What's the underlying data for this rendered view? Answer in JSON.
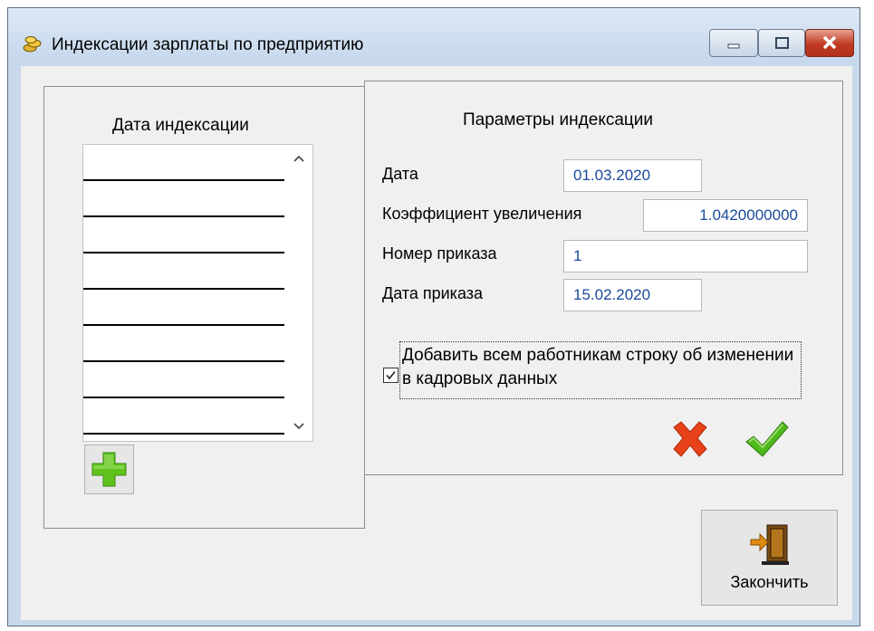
{
  "window": {
    "title": "Индексации зарплаты по предприятию"
  },
  "left_panel": {
    "title": "Дата индексации",
    "rows": [
      "",
      "",
      "",
      "",
      "",
      "",
      "",
      ""
    ]
  },
  "right_panel": {
    "title": "Параметры индексации",
    "fields": {
      "date": {
        "label": "Дата",
        "value": "01.03.2020"
      },
      "coefficient": {
        "label": "Коэффициент увеличения",
        "value": "1.0420000000"
      },
      "order_number": {
        "label": "Номер приказа",
        "value": "1"
      },
      "order_date": {
        "label": "Дата приказа",
        "value": "15.02.2020"
      }
    },
    "checkbox": {
      "label": "Добавить всем работникам строку об изменении в кадровых данных",
      "checked": true
    }
  },
  "buttons": {
    "finish": "Закончить"
  },
  "icons": {
    "app": "coins-icon",
    "add": "plus-icon",
    "cancel": "x-icon",
    "ok": "checkmark-icon",
    "finish": "door-exit-icon"
  },
  "colors": {
    "field_text": "#1a4a9e",
    "add": "#5fc31c",
    "cancel": "#e8421a",
    "ok": "#4fb81c"
  }
}
